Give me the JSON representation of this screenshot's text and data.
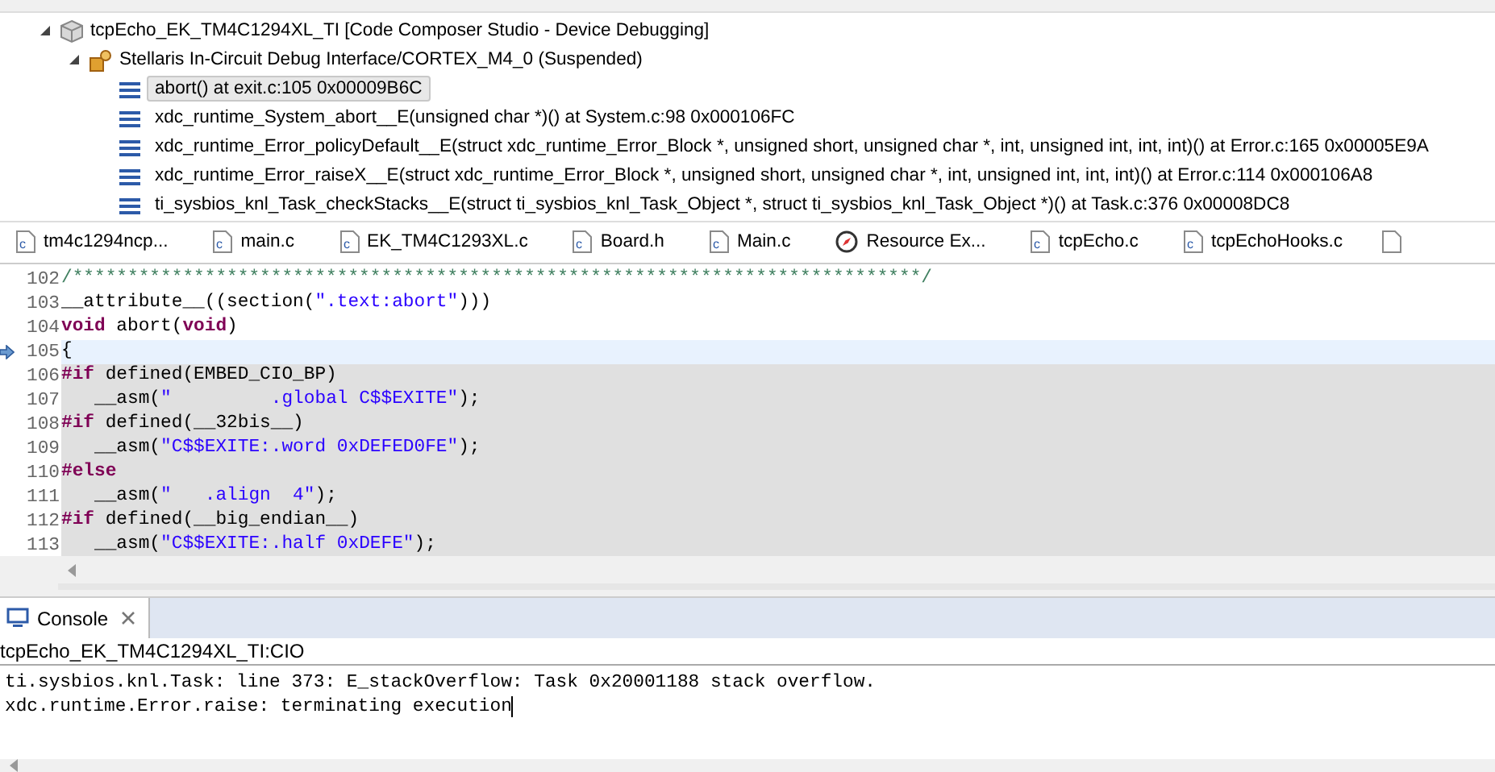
{
  "debug_tree": [
    {
      "label": "tcpEcho_EK_TM4C1294XL_TI [Code Composer Studio - Device Debugging]",
      "kind": "launch",
      "expanded": true,
      "children": [
        {
          "label": "Stellaris In-Circuit Debug Interface/CORTEX_M4_0 (Suspended)",
          "kind": "core",
          "expanded": true,
          "children": [
            {
              "label": "abort() at exit.c:105 0x00009B6C",
              "kind": "frame",
              "selected": true
            },
            {
              "label": "xdc_runtime_System_abort__E(unsigned char *)() at System.c:98 0x000106FC",
              "kind": "frame",
              "selected": false
            },
            {
              "label": "xdc_runtime_Error_policyDefault__E(struct xdc_runtime_Error_Block *, unsigned short, unsigned char *, int, unsigned int, int, int)() at Error.c:165 0x00005E9A",
              "kind": "frame",
              "selected": false
            },
            {
              "label": "xdc_runtime_Error_raiseX__E(struct xdc_runtime_Error_Block *, unsigned short, unsigned char *, int, unsigned int, int, int)() at Error.c:114 0x000106A8",
              "kind": "frame",
              "selected": false
            },
            {
              "label": "ti_sysbios_knl_Task_checkStacks__E(struct ti_sysbios_knl_Task_Object *, struct ti_sysbios_knl_Task_Object *)() at Task.c:376 0x00008DC8",
              "kind": "frame",
              "selected": false
            }
          ]
        }
      ]
    }
  ],
  "editor_tabs": [
    {
      "label": "tm4c1294ncp...",
      "kind": "c"
    },
    {
      "label": "main.c",
      "kind": "c"
    },
    {
      "label": "EK_TM4C1293XL.c",
      "kind": "c"
    },
    {
      "label": "Board.h",
      "kind": "c"
    },
    {
      "label": "Main.c",
      "kind": "c"
    },
    {
      "label": "Resource Ex...",
      "kind": "resource"
    },
    {
      "label": "tcpEcho.c",
      "kind": "c"
    },
    {
      "label": "tcpEchoHooks.c",
      "kind": "c"
    }
  ],
  "code_lines": [
    {
      "number": "102",
      "current": false,
      "inactive": false,
      "instruction_pointer": false,
      "tokens": [
        {
          "text": "/*****************************************************************************/",
          "kind": "comment"
        }
      ]
    },
    {
      "number": "103",
      "current": false,
      "inactive": false,
      "instruction_pointer": false,
      "tokens": [
        {
          "text": "__attribute__((section(",
          "kind": "plain"
        },
        {
          "text": "\".text:abort\"",
          "kind": "string"
        },
        {
          "text": ")))",
          "kind": "plain"
        }
      ]
    },
    {
      "number": "104",
      "current": false,
      "inactive": false,
      "instruction_pointer": false,
      "tokens": [
        {
          "text": "void",
          "kind": "keyword"
        },
        {
          "text": " abort(",
          "kind": "plain"
        },
        {
          "text": "void",
          "kind": "keyword"
        },
        {
          "text": ")",
          "kind": "plain"
        }
      ]
    },
    {
      "number": "105",
      "current": true,
      "inactive": false,
      "instruction_pointer": true,
      "tokens": [
        {
          "text": "{",
          "kind": "plain"
        }
      ]
    },
    {
      "number": "106",
      "current": false,
      "inactive": true,
      "instruction_pointer": false,
      "tokens": [
        {
          "text": "#if",
          "kind": "keyword"
        },
        {
          "text": " defined(EMBED_CIO_BP)",
          "kind": "plain"
        }
      ]
    },
    {
      "number": "107",
      "current": false,
      "inactive": true,
      "instruction_pointer": false,
      "tokens": [
        {
          "text": "   __asm(",
          "kind": "plain"
        },
        {
          "text": "\"         .global C$$EXITE\"",
          "kind": "string"
        },
        {
          "text": ");",
          "kind": "plain"
        }
      ]
    },
    {
      "number": "108",
      "current": false,
      "inactive": true,
      "instruction_pointer": false,
      "tokens": [
        {
          "text": "#if",
          "kind": "keyword"
        },
        {
          "text": " defined(__32bis__)",
          "kind": "plain"
        }
      ]
    },
    {
      "number": "109",
      "current": false,
      "inactive": true,
      "instruction_pointer": false,
      "tokens": [
        {
          "text": "   __asm(",
          "kind": "plain"
        },
        {
          "text": "\"C$$EXITE:.word 0xDEFED0FE\"",
          "kind": "string"
        },
        {
          "text": ");",
          "kind": "plain"
        }
      ]
    },
    {
      "number": "110",
      "current": false,
      "inactive": true,
      "instruction_pointer": false,
      "tokens": [
        {
          "text": "#else",
          "kind": "keyword"
        }
      ]
    },
    {
      "number": "111",
      "current": false,
      "inactive": true,
      "instruction_pointer": false,
      "tokens": [
        {
          "text": "   __asm(",
          "kind": "plain"
        },
        {
          "text": "\"   .align  4\"",
          "kind": "string"
        },
        {
          "text": ");",
          "kind": "plain"
        }
      ]
    },
    {
      "number": "112",
      "current": false,
      "inactive": true,
      "instruction_pointer": false,
      "tokens": [
        {
          "text": "#if",
          "kind": "keyword"
        },
        {
          "text": " defined(__big_endian__)",
          "kind": "plain"
        }
      ]
    },
    {
      "number": "113",
      "current": false,
      "inactive": true,
      "instruction_pointer": false,
      "tokens": [
        {
          "text": "   __asm(",
          "kind": "plain"
        },
        {
          "text": "\"C$$EXITE:.half 0xDEFE\"",
          "kind": "string"
        },
        {
          "text": ");",
          "kind": "plain"
        }
      ]
    }
  ],
  "console": {
    "tab": "Console",
    "title": "tcpEcho_EK_TM4C1294XL_TI:CIO",
    "lines": [
      "ti.sysbios.knl.Task: line 373: E_stackOverflow: Task 0x20001188 stack overflow.",
      "xdc.runtime.Error.raise: terminating execution"
    ]
  }
}
